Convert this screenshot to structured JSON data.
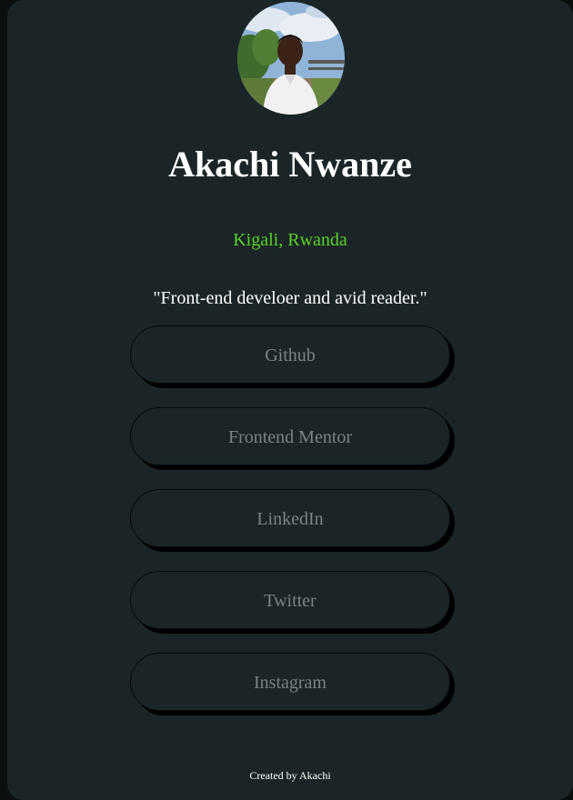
{
  "profile": {
    "name": "Akachi Nwanze",
    "location": "Kigali, Rwanda",
    "bio": "\"Front-end develoer and avid reader.\""
  },
  "links": [
    {
      "label": "Github"
    },
    {
      "label": "Frontend Mentor"
    },
    {
      "label": "LinkedIn"
    },
    {
      "label": "Twitter"
    },
    {
      "label": "Instagram"
    }
  ],
  "footer": {
    "text": "Created by Akachi"
  },
  "colors": {
    "background": "#1b2527",
    "location": "#59d325",
    "button_text": "#7c8384",
    "button_shadow": "#000000"
  }
}
